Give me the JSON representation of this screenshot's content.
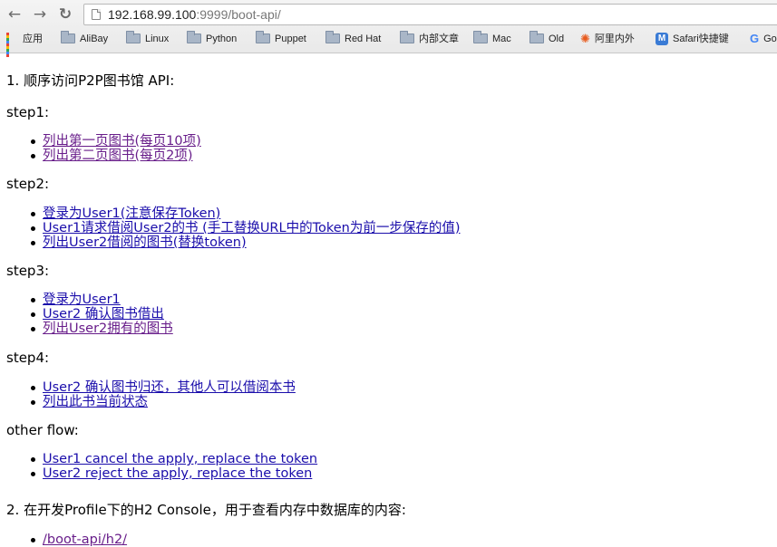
{
  "browser": {
    "nav": {
      "back": "←",
      "forward": "→",
      "reload": "↻"
    },
    "address": {
      "host": "192.168.99.100",
      "rest": ":9999/boot-api/"
    },
    "bookmarks": [
      {
        "label": "应用",
        "icon": "apps-grid-icon"
      },
      {
        "label": "AliBay",
        "icon": "folder-icon"
      },
      {
        "label": "Linux",
        "icon": "folder-icon"
      },
      {
        "label": "Python",
        "icon": "folder-icon"
      },
      {
        "label": "Puppet",
        "icon": "folder-icon"
      },
      {
        "label": "Red Hat",
        "icon": "folder-icon"
      },
      {
        "label": "内部文章",
        "icon": "folder-icon"
      },
      {
        "label": "Mac",
        "icon": "folder-icon"
      },
      {
        "label": "Old",
        "icon": "folder-icon"
      },
      {
        "label": "阿里内外",
        "icon": "alibaba-logo-icon"
      },
      {
        "label": "Safari快捷键",
        "icon": "m-logo-icon"
      },
      {
        "label": "Go",
        "icon": "google-logo-icon"
      }
    ]
  },
  "page": {
    "section1": "1. 顺序访问P2P图书馆 API:",
    "steps": [
      {
        "label": "step1:",
        "links": [
          {
            "text": "列出第一页图书(每页10项)",
            "visited": true
          },
          {
            "text": "列出第二页图书(每页2项)",
            "visited": true
          }
        ]
      },
      {
        "label": "step2:",
        "links": [
          {
            "text": "登录为User1(注意保存Token)",
            "visited": false
          },
          {
            "text": "User1请求借阅User2的书 (手工替换URL中的Token为前一步保存的值)",
            "visited": false
          },
          {
            "text": "列出User2借阅的图书(替换token)",
            "visited": false
          }
        ]
      },
      {
        "label": "step3:",
        "links": [
          {
            "text": "登录为User1",
            "visited": false
          },
          {
            "text": "User2 确认图书借出",
            "visited": false
          },
          {
            "text": "列出User2拥有的图书",
            "visited": true
          }
        ]
      },
      {
        "label": "step4:",
        "links": [
          {
            "text": "User2 确认图书归还，其他人可以借阅本书",
            "visited": false
          },
          {
            "text": "列出此书当前状态",
            "visited": false
          }
        ]
      },
      {
        "label": "other flow:",
        "links": [
          {
            "text": "User1 cancel the apply, replace the token",
            "visited": false
          },
          {
            "text": "User2 reject the apply, replace the token",
            "visited": false
          }
        ]
      }
    ],
    "section2": "2. 在开发Profile下的H2 Console，用于查看内存中数据库的内容:",
    "section2_links": [
      {
        "text": "/boot-api/h2/",
        "visited": true
      }
    ]
  }
}
